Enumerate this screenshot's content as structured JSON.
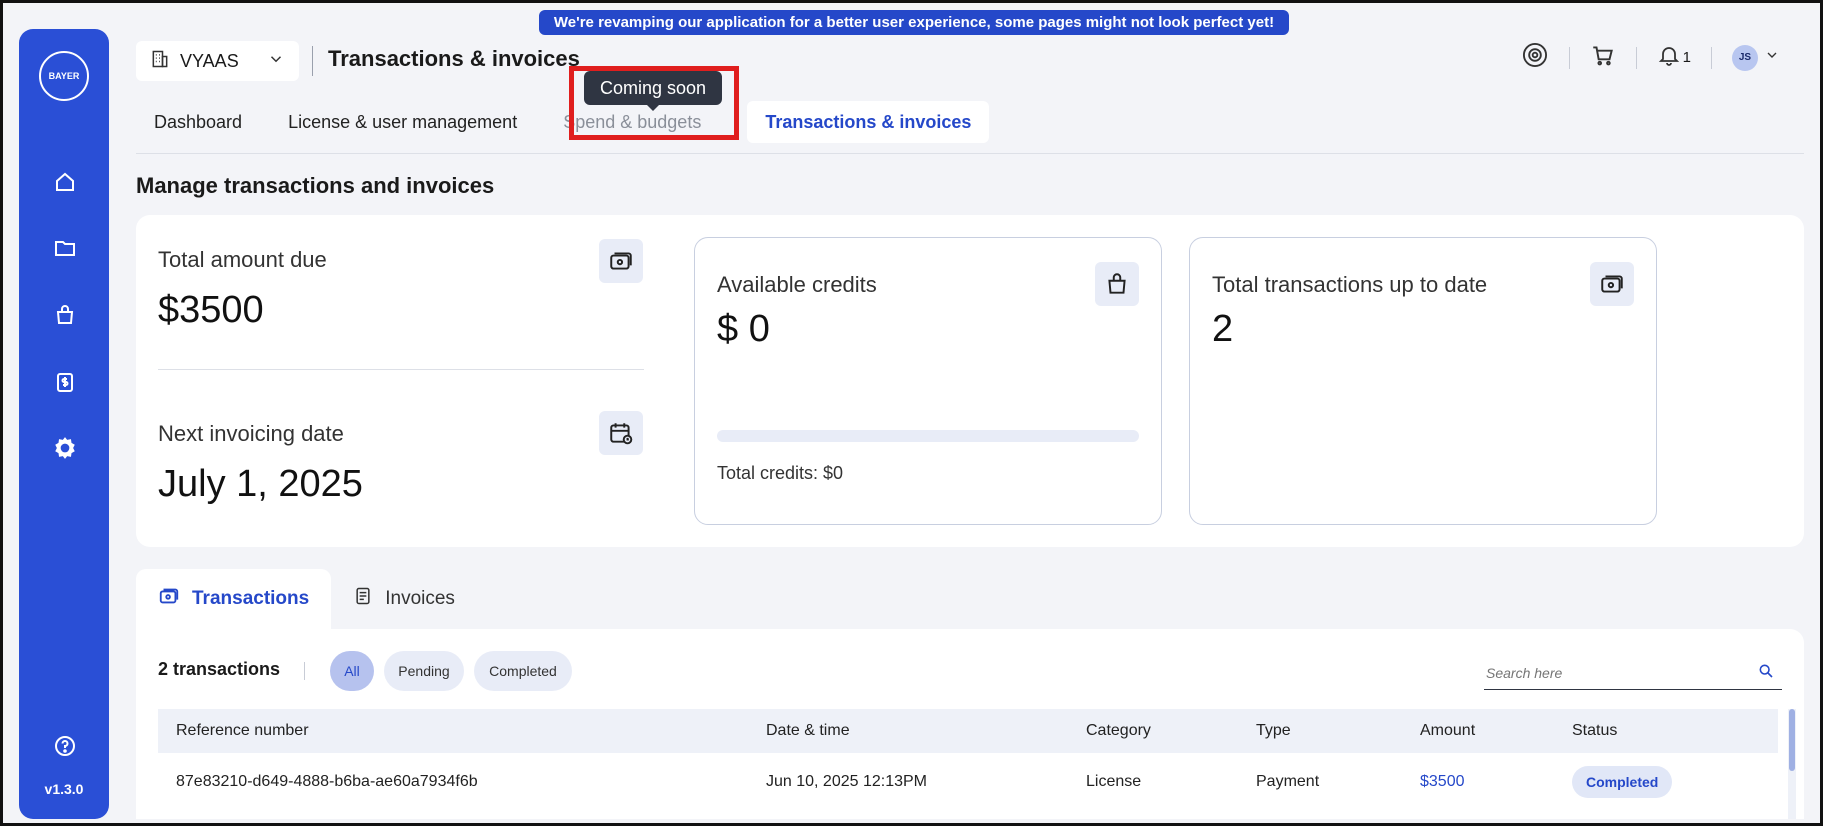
{
  "banner": {
    "text": "We're revamping our application for a better user experience, some pages might not look perfect yet!"
  },
  "sidebar": {
    "logo_text": "BAYER",
    "items": [
      {
        "icon": "home-icon"
      },
      {
        "icon": "folder-icon"
      },
      {
        "icon": "bag-icon"
      },
      {
        "icon": "clipboard-dollar-icon"
      },
      {
        "icon": "gear-icon"
      }
    ],
    "help_icon": "help-icon",
    "version": "v1.3.0"
  },
  "header": {
    "org": "VYAAS",
    "title": "Transactions & invoices",
    "notification_count": "1",
    "avatar_initials": "JS"
  },
  "tabs": [
    {
      "label": "Dashboard"
    },
    {
      "label": "License & user management"
    },
    {
      "label": "Spend & budgets"
    },
    {
      "label": "Transactions & invoices"
    }
  ],
  "tooltip": "Coming soon",
  "section_title": "Manage transactions and invoices",
  "summary": {
    "total_due_label": "Total amount due",
    "total_due_value": "$3500",
    "next_invoice_label": "Next invoicing date",
    "next_invoice_value": "July 1, 2025",
    "credits_label": "Available credits",
    "credits_value": "$ 0",
    "credits_progress": 0,
    "total_credits": "Total credits: $0",
    "transactions_label": "Total transactions up to date",
    "transactions_value": "2"
  },
  "subtabs": [
    {
      "label": "Transactions"
    },
    {
      "label": "Invoices"
    }
  ],
  "table": {
    "count_label": "2 transactions",
    "filters": [
      "All",
      "Pending",
      "Completed"
    ],
    "search_placeholder": "Search here",
    "columns": [
      "Reference number",
      "Date & time",
      "Category",
      "Type",
      "Amount",
      "Status"
    ],
    "rows": [
      {
        "reference": "87e83210-d649-4888-b6ba-ae60a7934f6b",
        "datetime": "Jun 10, 2025 12:13PM",
        "category": "License",
        "type": "Payment",
        "amount": "$3500",
        "status": "Completed"
      }
    ]
  },
  "colors": {
    "primary": "#2548c9",
    "sidebar": "#2a4fd6",
    "highlight": "#e01e1e"
  }
}
